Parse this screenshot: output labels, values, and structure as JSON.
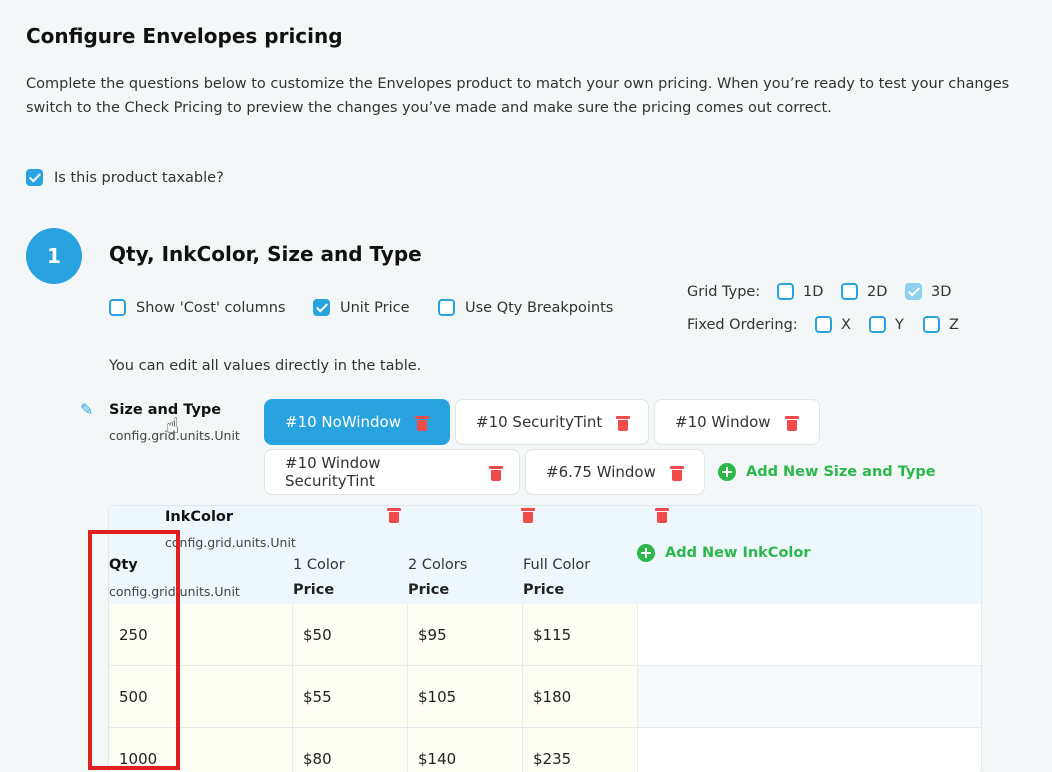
{
  "page": {
    "title": "Configure Envelopes pricing",
    "description": "Complete the questions below to customize the Envelopes product to match your own pricing. When you’re ready to test your changes switch to the Check Pricing to preview the changes you’ve made and make sure the pricing comes out correct.",
    "taxable_label": "Is this product taxable?",
    "taxable_checked": true
  },
  "step": {
    "number": "1",
    "title": "Qty, InkColor, Size and Type",
    "options": [
      {
        "label": "Show 'Cost' columns",
        "checked": false
      },
      {
        "label": "Unit Price",
        "checked": true
      },
      {
        "label": "Use Qty Breakpoints",
        "checked": false
      }
    ],
    "grid_type_label": "Grid Type:",
    "grid_types": [
      {
        "label": "1D",
        "checked": false
      },
      {
        "label": "2D",
        "checked": false
      },
      {
        "label": "3D",
        "checked": true
      }
    ],
    "fixed_ordering_label": "Fixed Ordering:",
    "fixed_ordering": [
      {
        "label": "X",
        "checked": false
      },
      {
        "label": "Y",
        "checked": false
      },
      {
        "label": "Z",
        "checked": false
      }
    ],
    "hint": "You can edit all values directly in the table."
  },
  "size_type": {
    "label": "Size and Type",
    "unit": "config.grid.units.Unit",
    "chips": [
      "#10 NoWindow",
      "#10 SecurityTint",
      "#10 Window",
      "#10 Window SecurityTint",
      "#6.75 Window"
    ],
    "active": "#10 NoWindow",
    "add_label": "Add New Size and Type"
  },
  "grid": {
    "inkcolor_label": "InkColor",
    "inkcolor_unit": "config.grid.units.Unit",
    "qty_label": "Qty",
    "qty_unit": "config.grid.units.Unit",
    "add_inkcolor_label": "Add New InkColor",
    "price_label": "Price",
    "columns": [
      "1 Color",
      "2 Colors",
      "Full Color"
    ],
    "rows": [
      {
        "qty": "250",
        "prices": [
          "$50",
          "$95",
          "$115"
        ]
      },
      {
        "qty": "500",
        "prices": [
          "$55",
          "$105",
          "$180"
        ]
      },
      {
        "qty": "1000",
        "prices": [
          "$80",
          "$140",
          "$235"
        ]
      }
    ]
  },
  "colors": {
    "accent": "#29a3e0",
    "danger": "#ef4b4b",
    "success": "#2bb84a",
    "highlight_box": "#e02020"
  }
}
